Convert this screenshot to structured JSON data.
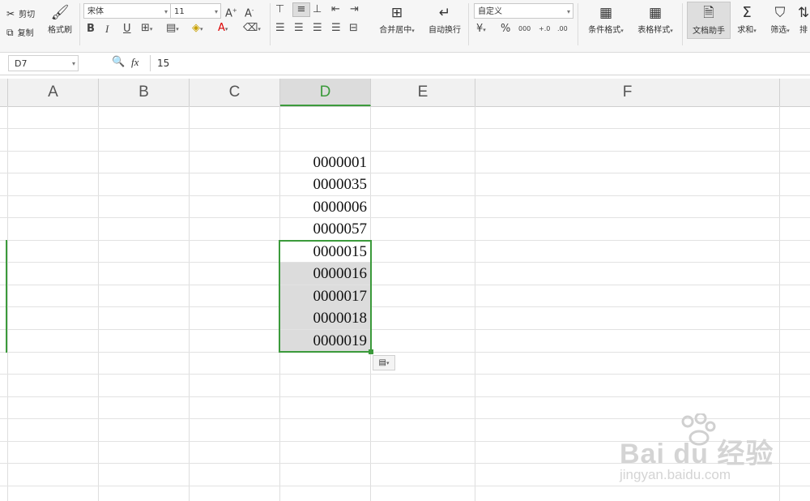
{
  "ribbon": {
    "cut": "剪切",
    "copy": "复制",
    "format_painter": "格式刷",
    "font_name": "宋体",
    "font_size": "11",
    "merge_center": "合并居中",
    "wrap_text": "自动换行",
    "number_format": "自定义",
    "conditional_format": "条件格式",
    "table_style": "表格样式",
    "doc_assistant": "文档助手",
    "sum": "求和",
    "filter": "筛选",
    "sort": "排",
    "bold": "B",
    "italic": "I",
    "underline": "U",
    "percent": "%",
    "thousands": "000",
    "inc_decimal": "+.0",
    "dec_decimal": ".00"
  },
  "formula_bar": {
    "name_box": "D7",
    "fx": "fx",
    "value": "15"
  },
  "columns": [
    "A",
    "B",
    "C",
    "D",
    "E",
    "F"
  ],
  "cells": [
    "0000001",
    "0000035",
    "0000006",
    "0000057",
    "0000015",
    "0000016",
    "0000017",
    "0000018",
    "0000019"
  ],
  "watermark": {
    "brand": "Bai du 经验",
    "url": "jingyan.baidu.com"
  },
  "colors": {
    "accent": "#3b9a3b",
    "header_bg": "#f1f1f1",
    "selection_bg": "#dcdcdc"
  }
}
